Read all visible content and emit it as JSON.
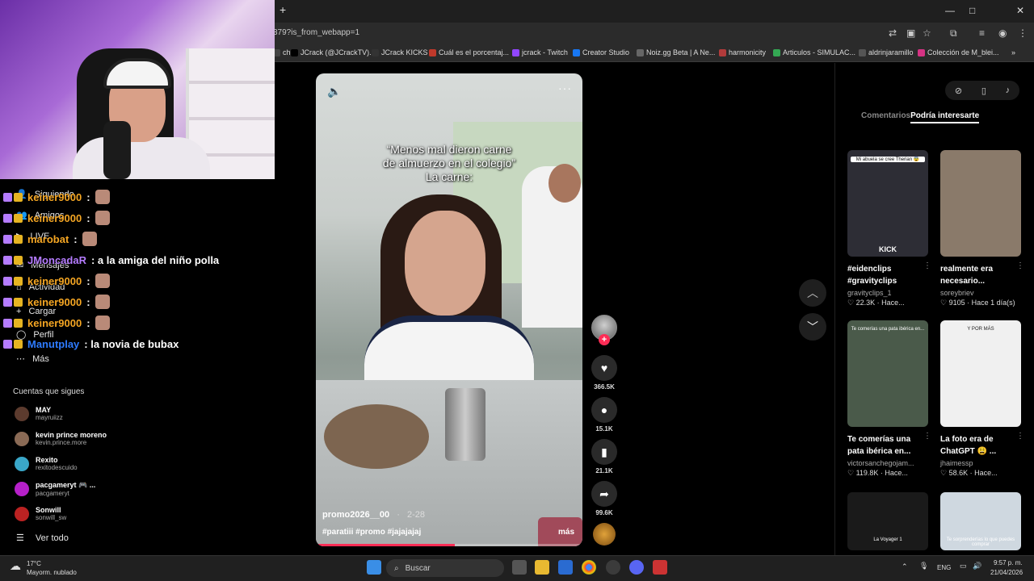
{
  "browser": {
    "url_fragment": "379?is_from_webapp=1",
    "new_tab": "+",
    "bookmarks": [
      {
        "label": "ch",
        "color": "#444"
      },
      {
        "label": "JCrack (@JCrackTV)...",
        "color": "#000"
      },
      {
        "label": "JCrack KICKS",
        "color": "#333"
      },
      {
        "label": "Cuál es el porcentaj...",
        "color": "#c0392b"
      },
      {
        "label": "jcrack - Twitch",
        "color": "#9146ff"
      },
      {
        "label": "Creator Studio",
        "color": "#1877f2"
      },
      {
        "label": "Noiz.gg Beta | A Ne...",
        "color": "#666"
      },
      {
        "label": "harmonicity",
        "color": "#b23b3b"
      },
      {
        "label": "Articulos - SIMULAC...",
        "color": "#34a853"
      },
      {
        "label": "aldrinjaramillo",
        "color": "#555"
      },
      {
        "label": "Colección de M_blei...",
        "color": "#d63384"
      }
    ]
  },
  "sidebar": {
    "items": [
      "Siguiendo",
      "Amigos",
      "LIVE",
      "Mensajes",
      "Actividad",
      "Cargar",
      "Perfil",
      "Más"
    ],
    "following_title": "Cuentas que sigues",
    "following": [
      {
        "name": "MAY",
        "user": "mayruiizz",
        "color": "#5c3b2e"
      },
      {
        "name": "kevin prince moreno",
        "user": "kevin.prince.more",
        "color": "#8a6a55"
      },
      {
        "name": "Rexito",
        "user": "rexitodescuido",
        "color": "#3aa7c9"
      },
      {
        "name": "pacgameryt 🎮 ...",
        "user": "pacgameryt",
        "color": "#b620c9"
      },
      {
        "name": "Sonwill",
        "user": "sonwill_sw",
        "color": "#b22"
      }
    ],
    "see_all": "Ver todo"
  },
  "chat": [
    {
      "user": "keiner9000",
      "color": "#f5a623",
      "text": ":",
      "emote": true
    },
    {
      "user": "keiner9000",
      "color": "#f5a623",
      "text": ":",
      "emote": true
    },
    {
      "user": "marobat",
      "color": "#f5a623",
      "text": ":",
      "emote": true
    },
    {
      "user": "JMoncadaR",
      "color": "#b57cff",
      "text": ": a la amiga del niño polla",
      "emote": false
    },
    {
      "user": "keiner9000",
      "color": "#f5a623",
      "text": ":",
      "emote": true
    },
    {
      "user": "keiner9000",
      "color": "#f5a623",
      "text": ":",
      "emote": true
    },
    {
      "user": "keiner9000",
      "color": "#f5a623",
      "text": ":",
      "emote": true
    },
    {
      "user": "Manutplay",
      "color": "#2e7bff",
      "text": ": la novia de bubax",
      "emote": false
    }
  ],
  "video": {
    "caption_l1": "“Menos mal dieron carne",
    "caption_l2": "de almuerzo en el colegio”",
    "caption_l3": "La carne:",
    "author": "promo2026__00",
    "date": "2-28",
    "hashtags": "#paratiii #promo #jajajajaj",
    "more": "más",
    "progress": 0.52,
    "likes": "366.5K",
    "comments": "15.1K",
    "saves": "21.1K",
    "shares": "99.6K"
  },
  "rightpanel": {
    "tab_comments": "Comentarios",
    "tab_suggested": "Podría interesarte",
    "cards": [
      {
        "title": "#eidenclips #gravityclips",
        "author": "gravityclips_1",
        "stats": "♡ 22.3K · Hace...",
        "thumb": "#2d2d35",
        "overlay": "Mi abuela se cree Therian 😨",
        "overlay2": "KICK"
      },
      {
        "title": "realmente era necesario...",
        "author": "soreybriev",
        "stats": "♡ 9105 · Hace 1 día(s)",
        "thumb": "#8a7a6a",
        "overlay": "",
        "overlay2": ""
      },
      {
        "title": "Te comerías una pata ibérica en...",
        "author": "victorsanchegojam...",
        "stats": "♡ 119.8K · Hace...",
        "thumb": "#4a5a4a",
        "overlay": "Te comerías una pata ibérica en...",
        "overlay2": ""
      },
      {
        "title": "La foto era de ChatGPT 😩 ...",
        "author": "jhaimessp",
        "stats": "♡ 58.6K · Hace...",
        "thumb": "#f0f0f0",
        "overlay": "Y POR MÁS",
        "overlay2": ""
      },
      {
        "title": "",
        "author": "",
        "stats": "",
        "thumb": "#1a1a1a",
        "overlay": "La Voyager 1",
        "overlay2": ""
      },
      {
        "title": "",
        "author": "",
        "stats": "",
        "thumb": "#cfd8e0",
        "overlay": "Te sorprenderías lo que puedes comprar",
        "overlay2": ""
      }
    ]
  },
  "taskbar": {
    "weather_temp": "17°C",
    "weather_text": "Mayorm. nublado",
    "search": "Buscar",
    "lang": "ENG",
    "time": "9:57 p. m.",
    "date": "21/04/2026"
  }
}
